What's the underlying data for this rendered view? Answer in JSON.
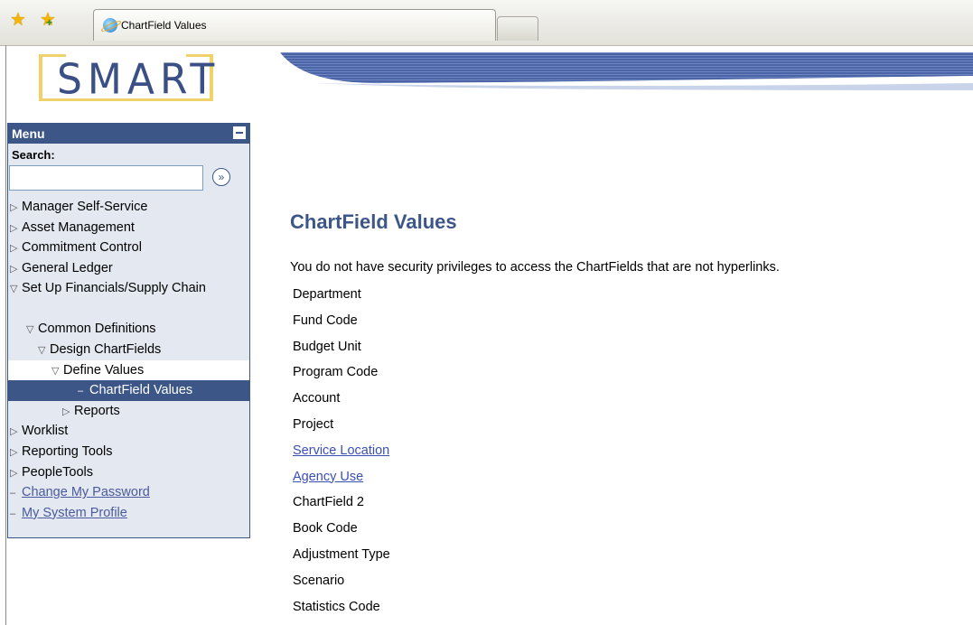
{
  "browser": {
    "tab_title": "ChartField Values"
  },
  "logo": {
    "text": "SMART"
  },
  "menu": {
    "title": "Menu",
    "search_label": "Search:",
    "search_value": "",
    "go_symbol": "»",
    "items": [
      {
        "label": "Manager Self-Service",
        "arrow": "▷"
      },
      {
        "label": "Asset Management",
        "arrow": "▷"
      },
      {
        "label": "Commitment Control",
        "arrow": "▷"
      },
      {
        "label": "General Ledger",
        "arrow": "▷"
      },
      {
        "label": "Set Up Financials/Supply Chain",
        "arrow": "▽"
      },
      {
        "label": "Common Definitions",
        "arrow": "▽"
      },
      {
        "label": "Design ChartFields",
        "arrow": "▽"
      },
      {
        "label": "Define Values",
        "arrow": "▽"
      },
      {
        "label": "ChartField Values",
        "arrow": "–"
      },
      {
        "label": "Reports",
        "arrow": "▷"
      },
      {
        "label": "Worklist",
        "arrow": "▷"
      },
      {
        "label": "Reporting Tools",
        "arrow": "▷"
      },
      {
        "label": "PeopleTools",
        "arrow": "▷"
      },
      {
        "label": "Change My Password",
        "arrow": "–"
      },
      {
        "label": "My System Profile",
        "arrow": "–"
      }
    ]
  },
  "main": {
    "title": "ChartField Values",
    "notice": "You do not have security privileges to access the ChartFields that are not hyperlinks.",
    "chartfields": [
      {
        "label": "Department",
        "link": false
      },
      {
        "label": "Fund Code",
        "link": false
      },
      {
        "label": "Budget Unit",
        "link": false
      },
      {
        "label": "Program Code",
        "link": false
      },
      {
        "label": "Account",
        "link": false
      },
      {
        "label": "Project",
        "link": false
      },
      {
        "label": "Service Location",
        "link": true
      },
      {
        "label": "Agency Use",
        "link": true
      },
      {
        "label": "ChartField 2",
        "link": false
      },
      {
        "label": "Book Code",
        "link": false
      },
      {
        "label": "Adjustment Type",
        "link": false
      },
      {
        "label": "Scenario",
        "link": false
      },
      {
        "label": "Statistics Code",
        "link": false
      }
    ]
  },
  "colors": {
    "brand_blue": "#3d5688",
    "link_blue": "#3a4fb4",
    "menu_bg": "#e4e8f0",
    "logo_gold": "#f0d26a"
  }
}
